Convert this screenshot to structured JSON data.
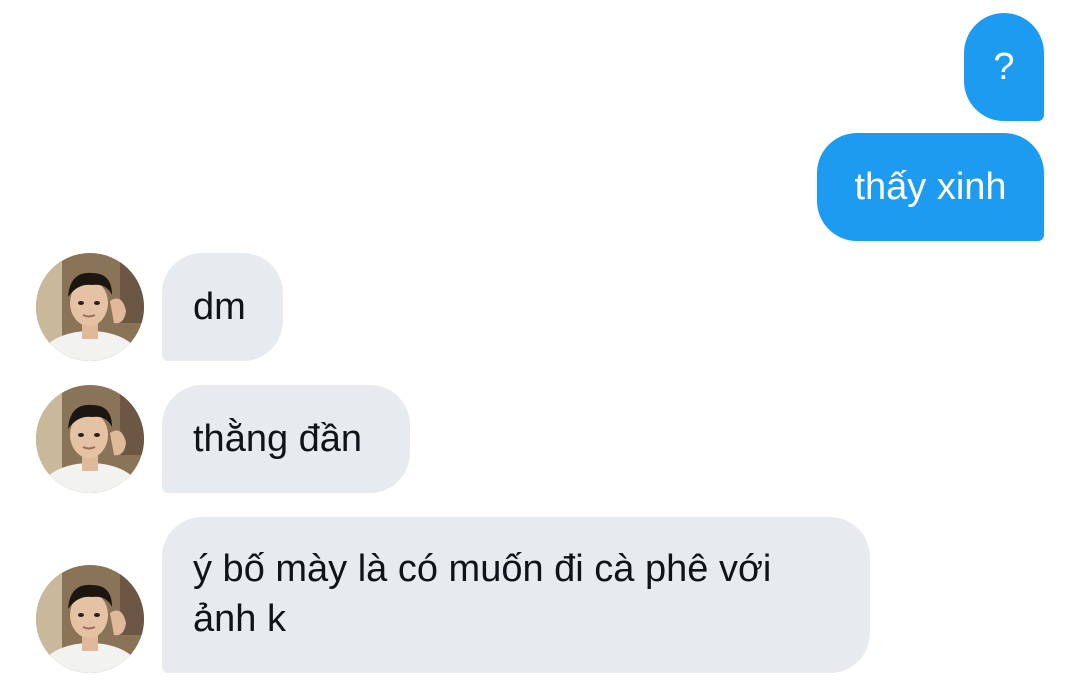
{
  "conversation": {
    "messages": [
      {
        "direction": "sent",
        "lines": [
          "?"
        ]
      },
      {
        "direction": "sent",
        "lines": [
          "thấy xinh"
        ]
      },
      {
        "direction": "received",
        "lines": [
          "dm"
        ]
      },
      {
        "direction": "received",
        "lines": [
          "thằng đần"
        ]
      },
      {
        "direction": "received",
        "lines": [
          "ý bố mày là có muốn đi cà phê với",
          "ảnh k"
        ]
      }
    ]
  },
  "colors": {
    "sent_bubble": "#1d9bf0",
    "received_bubble": "#e7ebef",
    "sent_text": "#ffffff",
    "received_text": "#0f1419"
  },
  "icons": {
    "contact_avatar": "avatar-photo-icon"
  }
}
